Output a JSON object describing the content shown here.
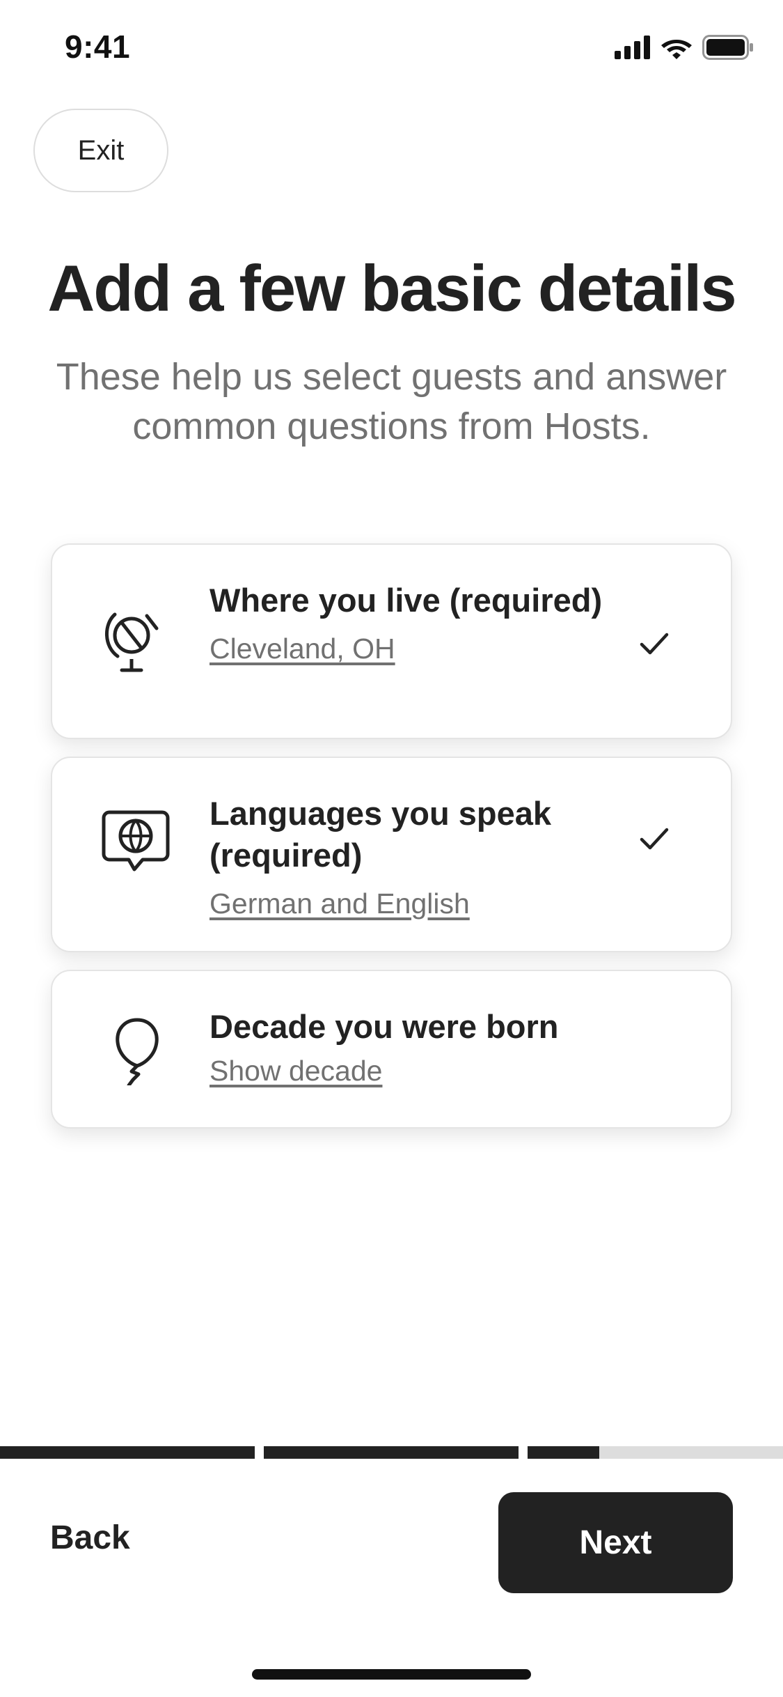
{
  "status_bar": {
    "time": "9:41",
    "icons": [
      "cellular-signal-icon",
      "wifi-icon",
      "battery-icon"
    ]
  },
  "header": {
    "exit_label": "Exit"
  },
  "main": {
    "title": "Add a few basic details",
    "subtitle": "These help us select guests and answer common questions from Hosts."
  },
  "cards": [
    {
      "icon": "globe-icon",
      "title": "Where you live (required)",
      "link": "Cleveland, OH",
      "completed": true
    },
    {
      "icon": "language-bubble-icon",
      "title": "Languages you speak (required)",
      "link": "German and English",
      "completed": true
    },
    {
      "icon": "balloon-icon",
      "title": "Decade you were born",
      "link": "Show decade",
      "completed": false
    }
  ],
  "progress": {
    "segments": [
      1.0,
      1.0,
      0.28
    ]
  },
  "footer": {
    "back_label": "Back",
    "next_label": "Next"
  },
  "colors": {
    "text_primary": "#222222",
    "text_secondary": "#717171",
    "progress_filled": "#222222",
    "progress_empty": "#dddddd",
    "next_button_bg": "#222222"
  }
}
